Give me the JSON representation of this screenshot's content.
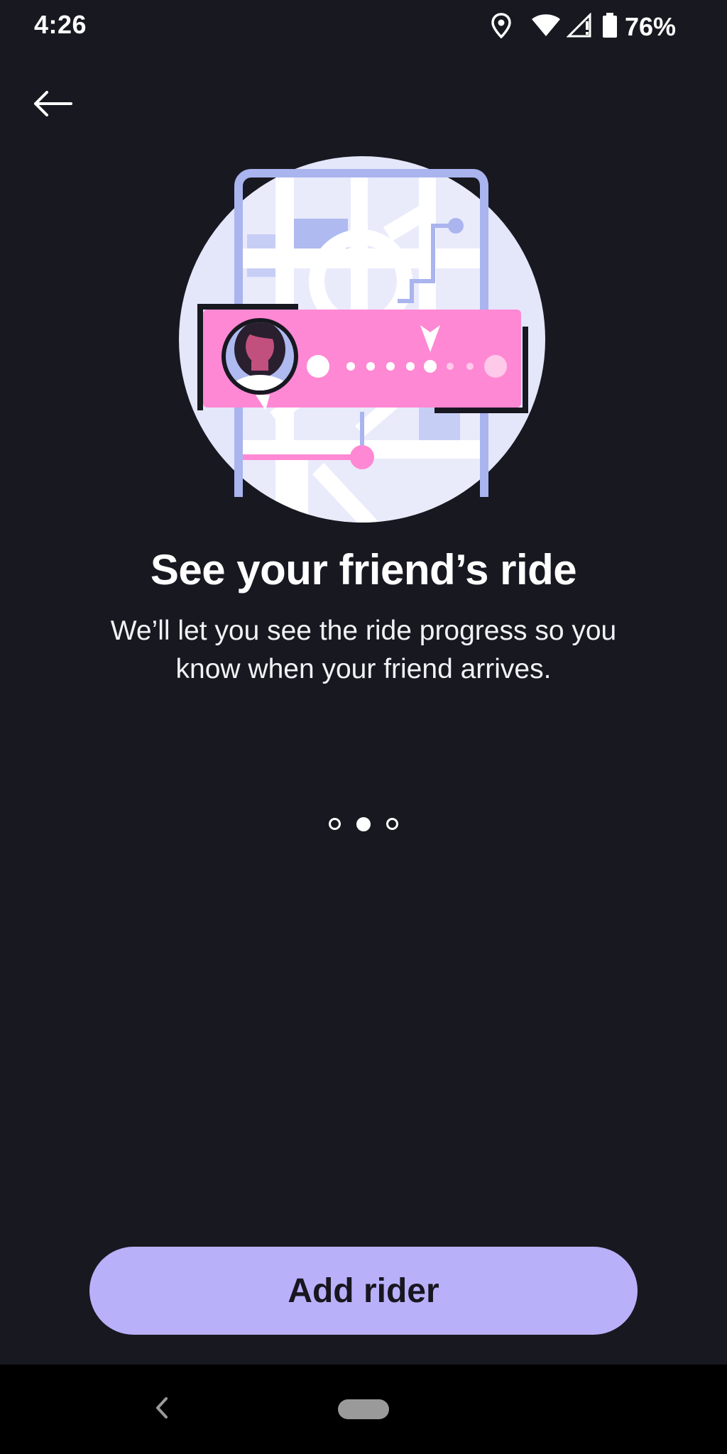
{
  "status_bar": {
    "time": "4:26",
    "battery_percent": "76%",
    "icons": [
      "location-icon",
      "wifi-icon",
      "cell-signal-icon",
      "battery-icon"
    ]
  },
  "header": {
    "back_icon": "arrow-left-icon"
  },
  "onboarding": {
    "illustration": "map-friend-ride-illustration",
    "title": "See your friend’s ride",
    "subtitle": "We’ll let you see the ride progress so you know when your friend arrives.",
    "pager": {
      "total": 3,
      "active_index": 1
    }
  },
  "actions": {
    "primary_label": "Add rider"
  },
  "nav_bar": {
    "back_icon": "chevron-left-icon",
    "home_pill": "home-pill"
  },
  "colors": {
    "background": "#181820",
    "accent": "#b9b0fa",
    "pink": "#ff88d4",
    "map_circle": "#e4e6fa",
    "map_blue": "#aab4ee"
  }
}
